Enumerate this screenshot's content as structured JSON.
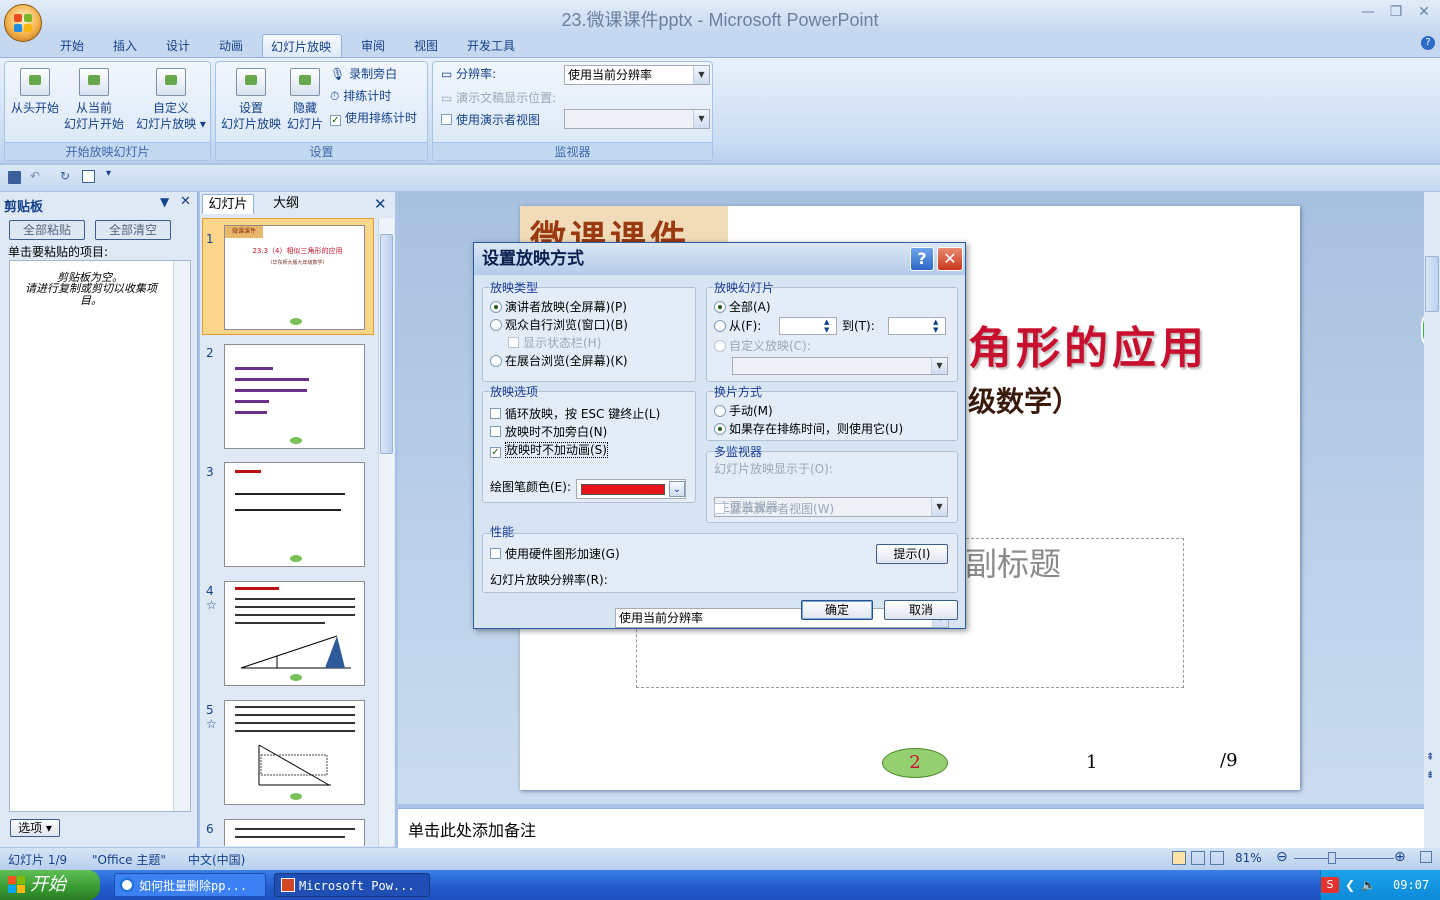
{
  "window": {
    "title": "23.微课课件pptx - Microsoft PowerPoint",
    "min": "—",
    "max": "❐",
    "close": "✕"
  },
  "tabs": [
    "开始",
    "插入",
    "设计",
    "动画",
    "幻灯片放映",
    "审阅",
    "视图",
    "开发工具"
  ],
  "active_tab": "幻灯片放映",
  "ribbon": {
    "group_start": {
      "label": "开始放映幻灯片",
      "from_beginning": "从头开始",
      "from_current_1": "从当前",
      "from_current_2": "幻灯片开始",
      "custom_1": "自定义",
      "custom_2": "幻灯片放映"
    },
    "group_setup": {
      "label": "设置",
      "setup_1": "设置",
      "setup_2": "幻灯片放映",
      "hide_1": "隐藏",
      "hide_2": "幻灯片",
      "record": "录制旁白",
      "rehearse": "排练计时",
      "use_timings": "使用排练计时"
    },
    "group_monitors": {
      "label": "监视器",
      "resolution_label": "分辨率:",
      "resolution_value": "使用当前分辨率",
      "show_on_label": "演示文稿显示位置:",
      "presenter_view": "使用演示者视图"
    }
  },
  "clipboard": {
    "title": "剪贴板",
    "paste_all": "全部粘贴",
    "clear_all": "全部清空",
    "instruction": "单击要粘贴的项目:",
    "empty_1": "剪贴板为空。",
    "empty_2": "请进行复制或剪切以收集项目。",
    "options": "选项 ▾"
  },
  "slides_pane": {
    "tab_slides": "幻灯片",
    "tab_outline": "大纲",
    "thumb1_header": "微课课件",
    "thumb1_title": "23.3（4）相似三角形的应用",
    "thumb1_sub": "（华东师大版九年级数学）",
    "thumbs": [
      {
        "num": "1",
        "star": ""
      },
      {
        "num": "2",
        "star": ""
      },
      {
        "num": "3",
        "star": ""
      },
      {
        "num": "4",
        "star": "☆"
      },
      {
        "num": "5",
        "star": "☆"
      },
      {
        "num": "6",
        "star": ""
      }
    ]
  },
  "slide": {
    "header": "微课课件",
    "title_visible": "角形的应用",
    "subtitle_visible": "级数学）",
    "placeholder_visible": "副标题",
    "oval_num": "2",
    "page_num": "1",
    "page_total": "/9"
  },
  "notes": "单击此处添加备注",
  "status": {
    "slide": "幻灯片 1/9",
    "theme": "\"Office 主题\"",
    "lang": "中文(中国)",
    "zoom": "81%"
  },
  "dialog": {
    "title": "设置放映方式",
    "help": "?",
    "close": "✕",
    "show_type": {
      "title": "放映类型",
      "presenter": "演讲者放映(全屏幕)(P)",
      "browsed_window": "观众自行浏览(窗口)(B)",
      "show_status": "显示状态栏(H)",
      "kiosk": "在展台浏览(全屏幕)(K)"
    },
    "show_slides": {
      "title": "放映幻灯片",
      "all": "全部(A)",
      "from": "从(F):",
      "to": "到(T):",
      "custom": "自定义放映(C):"
    },
    "show_options": {
      "title": "放映选项",
      "loop": "循环放映，按 ESC 键终止(L)",
      "no_narration": "放映时不加旁白(N)",
      "no_animation": "放映时不加动画(S)",
      "pen_color_label": "绘图笔颜色(E):",
      "pen_color": "#e8141c"
    },
    "advance": {
      "title": "换片方式",
      "manually": "手动(M)",
      "timings": "如果存在排练时间，则使用它(U)"
    },
    "multi_monitor": {
      "title": "多监视器",
      "display_on": "幻灯片放映显示于(O):",
      "monitor_value": "主要监视器",
      "presenter_view": "显示演示者视图(W)"
    },
    "performance": {
      "title": "性能",
      "hw_accel": "使用硬件图形加速(G)",
      "tips": "提示(I)",
      "resolution_label": "幻灯片放映分辨率(R):",
      "resolution_value": "使用当前分辨率"
    },
    "ok": "确定",
    "cancel": "取消"
  },
  "taskbar": {
    "start": "开始",
    "task1": "如何批量删除pp...",
    "task2": "Microsoft Pow...",
    "time": "09:07"
  }
}
